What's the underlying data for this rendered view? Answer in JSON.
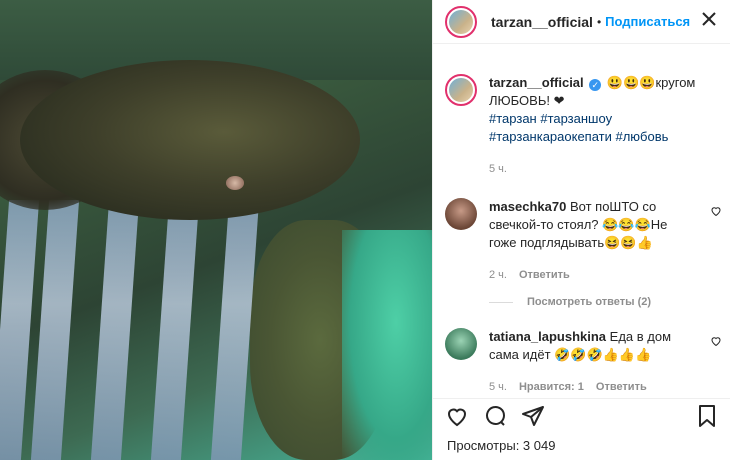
{
  "post": {
    "username": "tarzan__official",
    "follow_label": "Подписаться",
    "dot": "•"
  },
  "caption": {
    "username": "tarzan__official",
    "emoji": "😃😃😃",
    "text_part1": "кругом",
    "text_part2": "ЛЮБОВЬ! ❤",
    "hashtags": "#тарзан #тарзаншоу",
    "hashtags2": "#тарзанкараокепати #любовь",
    "time": "5 ч."
  },
  "comments": [
    {
      "username": "masechka70",
      "text": "Вот поШТО со свечкой-то стоял? 😂😂😂Не гоже подглядывать😆😆👍",
      "time": "2 ч.",
      "reply_label": "Ответить",
      "view_replies": "Посмотреть ответы (2)"
    },
    {
      "username": "tatiana_lapushkina",
      "text": "Еда в дом сама идёт 🤣🤣🤣👍👍👍",
      "time": "5 ч.",
      "likes_label": "Нравится: 1",
      "reply_label": "Ответить"
    }
  ],
  "footer": {
    "views_label": "Просмотры: 3 049"
  },
  "colors": {
    "accent": "#0095f6",
    "hashtag": "#00376b",
    "meta": "#8e8e8e"
  }
}
